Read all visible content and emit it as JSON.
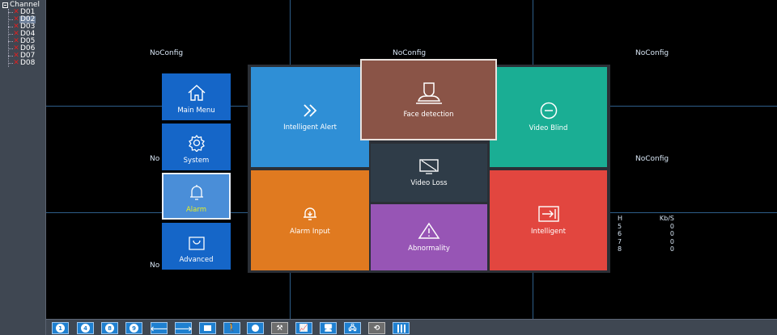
{
  "channel_panel": {
    "title": "Channel",
    "channels": [
      {
        "label": "D01",
        "status": "offline",
        "selected": false
      },
      {
        "label": "D02",
        "status": "offline",
        "selected": true
      },
      {
        "label": "D03",
        "status": "offline",
        "selected": false
      },
      {
        "label": "D04",
        "status": "offline",
        "selected": false
      },
      {
        "label": "D05",
        "status": "offline",
        "selected": false
      },
      {
        "label": "D06",
        "status": "offline",
        "selected": false
      },
      {
        "label": "D07",
        "status": "offline",
        "selected": false
      },
      {
        "label": "D08",
        "status": "offline",
        "selected": false
      }
    ]
  },
  "grid": {
    "labels": [
      "NoConfig",
      "NoConfig",
      "NoConfig",
      "No",
      "NoConfig",
      "No"
    ],
    "stats": {
      "header": [
        "H",
        "Kb/S"
      ],
      "rows": [
        [
          "5",
          "0"
        ],
        [
          "6",
          "0"
        ],
        [
          "7",
          "0"
        ],
        [
          "8",
          "0"
        ]
      ]
    }
  },
  "menu": {
    "items": [
      {
        "label": "Main Menu",
        "icon": "home-icon"
      },
      {
        "label": "System",
        "icon": "gear-icon"
      },
      {
        "label": "Alarm",
        "icon": "bell-icon",
        "active": true
      },
      {
        "label": "Advanced",
        "icon": "bag-icon"
      }
    ]
  },
  "alarm_panel": {
    "tiles": {
      "intelligent_alert": "Intelligent Alert",
      "face_detection": "Face detection",
      "video_blind": "Video Blind",
      "video_loss": "Video Loss",
      "alarm_input": "Alarm Input",
      "abnormality": "Abnormality",
      "intelligent": "Intelligent"
    },
    "colors": {
      "intelligent_alert": "#2f8fd6",
      "face_detection": "#8a5447",
      "video_blind": "#1aae94",
      "video_loss": "#2f3c48",
      "alarm_input": "#e07a20",
      "abnormality": "#9755b5",
      "intelligent": "#e2463f"
    }
  },
  "toolbar": {
    "layout_buttons": [
      "1",
      "4",
      "8",
      "9"
    ]
  }
}
